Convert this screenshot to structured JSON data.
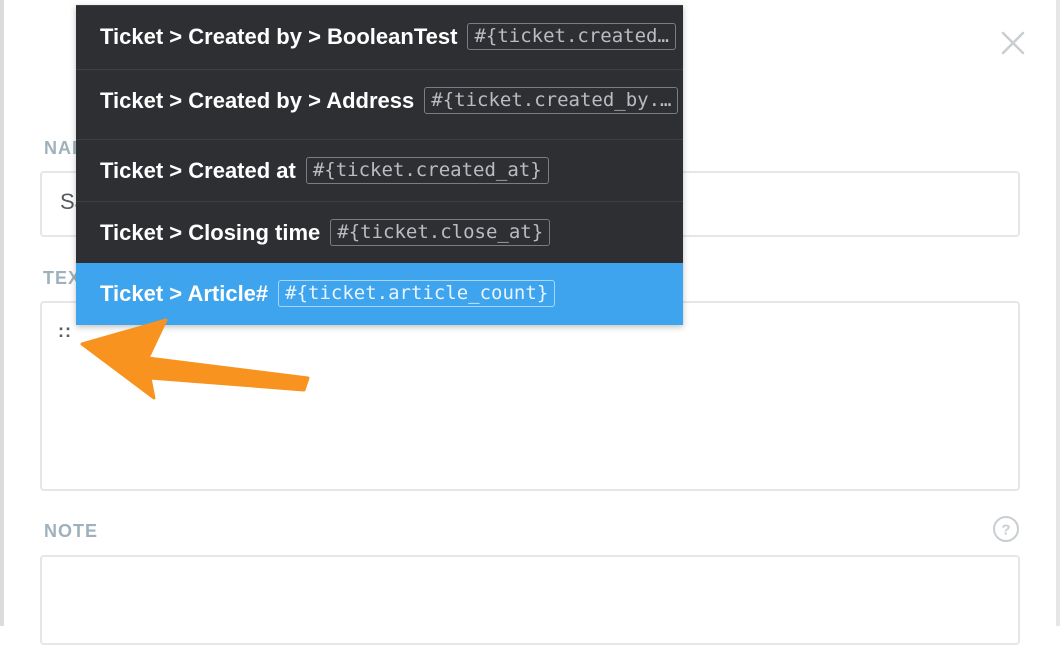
{
  "dialog": {
    "close_icon": "close-icon",
    "fields": {
      "name": {
        "label_partial": "NAI",
        "value_partial": "Sa"
      },
      "text": {
        "label_partial": "TEX",
        "value": "::"
      },
      "note": {
        "label": "NOTE",
        "value": "",
        "help_icon": "question-circle-icon"
      }
    }
  },
  "autocomplete": {
    "items": [
      {
        "label": "Ticket > Created by > BooleanTest",
        "code": "#{ticket.created…",
        "selected": false
      },
      {
        "label": "Ticket > Created by > Address",
        "code": "#{ticket.created_by.…",
        "selected": false
      },
      {
        "label": "Ticket > Created at",
        "code": "#{ticket.created_at}",
        "selected": false
      },
      {
        "label": "Ticket > Closing time",
        "code": "#{ticket.close_at}",
        "selected": false
      },
      {
        "label": "Ticket > Article#",
        "code": "#{ticket.article_count}",
        "selected": true
      }
    ]
  },
  "annotation": {
    "arrow_color": "#f7931e"
  },
  "colors": {
    "dropdown_bg": "#2d2f33",
    "selected_bg": "#3fa4ee",
    "label_color": "#9fb1bc"
  }
}
